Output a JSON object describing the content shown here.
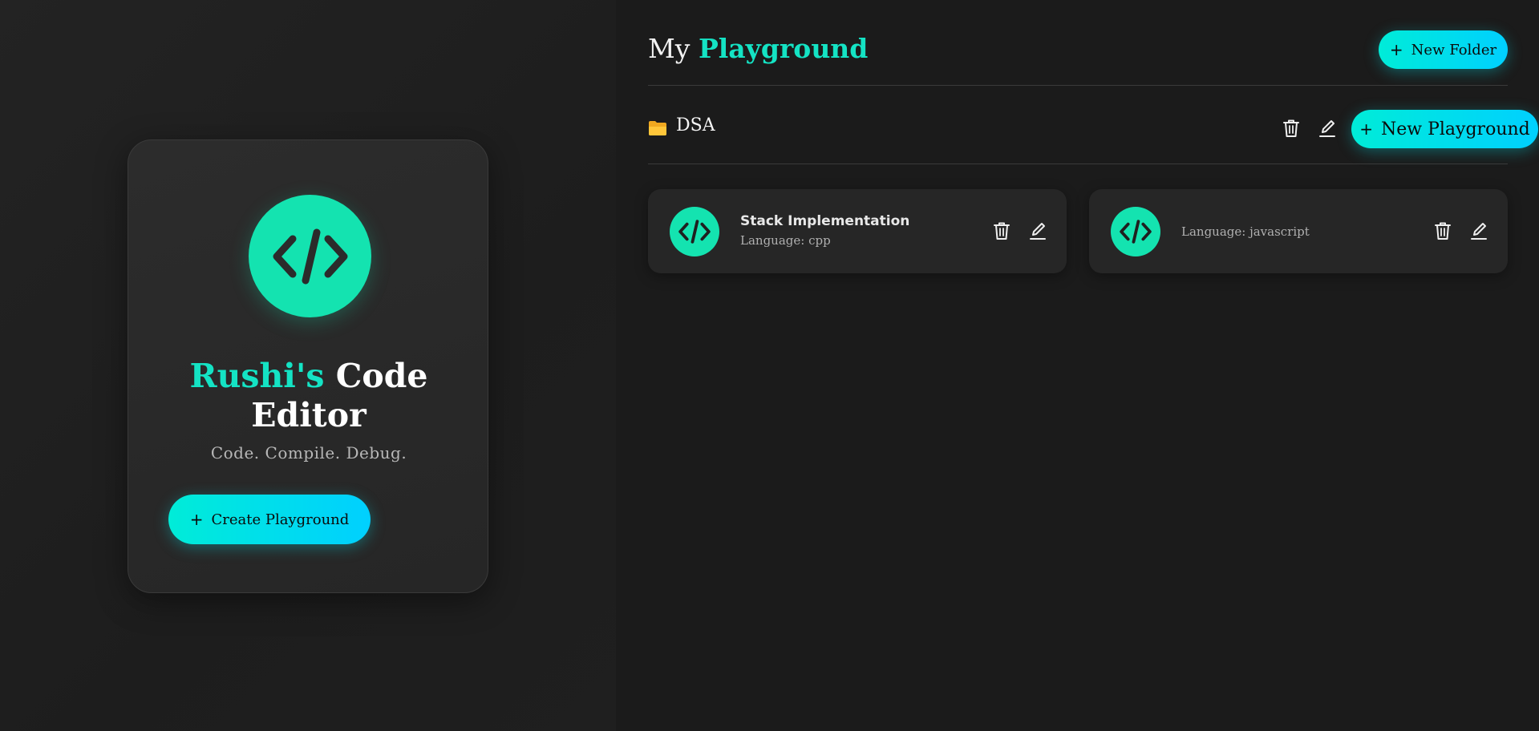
{
  "hero": {
    "title_accent": "Rushi's",
    "title_rest": "Code",
    "title_line2": "Editor",
    "tagline": "Code. Compile. Debug.",
    "create_button": "Create Playground",
    "logo_icon": "code-brackets-icon"
  },
  "header": {
    "title_prefix": "My",
    "title_accent": "Playground",
    "new_folder_button": "New Folder"
  },
  "folder": {
    "name": "DSA",
    "icon": "folder-icon",
    "new_playground_button": "New Playground"
  },
  "playgrounds": [
    {
      "name": "Stack Implementation",
      "language": "Language: cpp"
    },
    {
      "name": "",
      "language": "Language: javascript"
    }
  ],
  "colors": {
    "accent": "#14e3c4",
    "logo_bg": "#14e3b0",
    "button_gradient_start": "#00ecd8",
    "button_gradient_end": "#00d0ff",
    "background": "#1b1b1b",
    "card": "#262626"
  }
}
